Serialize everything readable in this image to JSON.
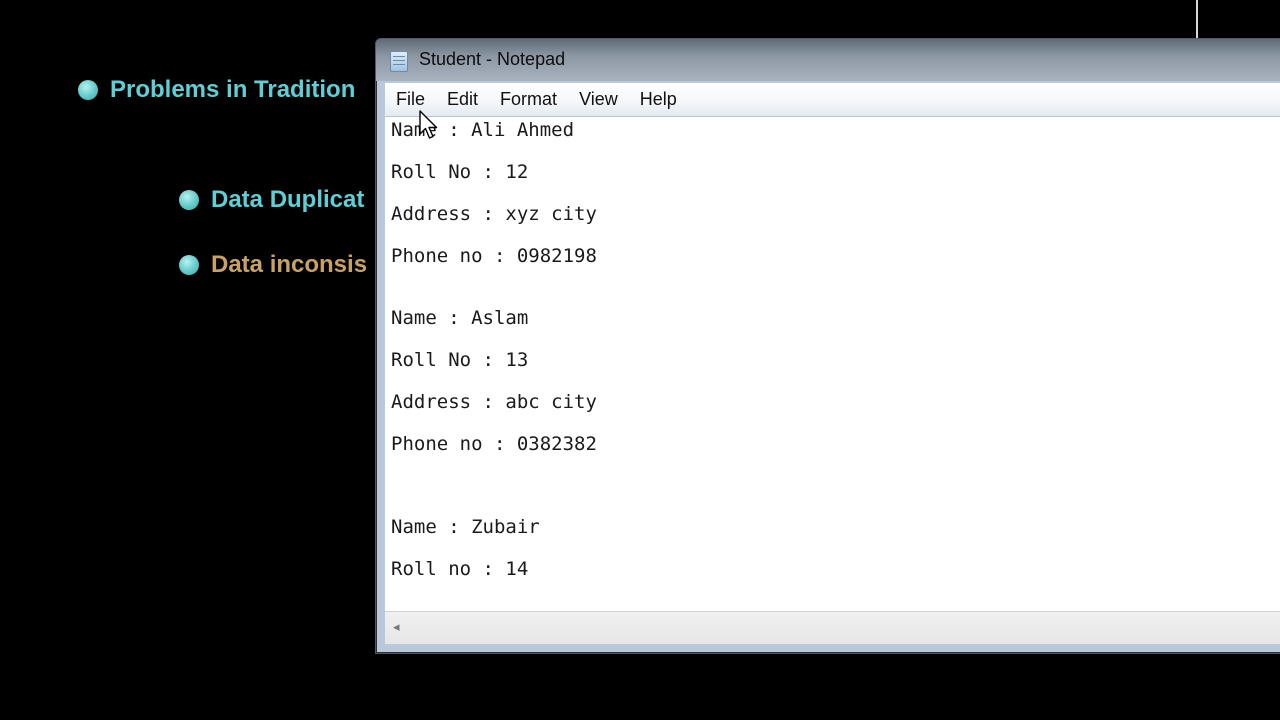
{
  "slide": {
    "bullets": [
      {
        "text": "Problems in Tradition",
        "color": "#5fcfd6"
      },
      {
        "text": "Data Duplicat",
        "color": "#5fcfd6"
      },
      {
        "text": "Data inconsis",
        "color": "#c7a264"
      }
    ]
  },
  "window": {
    "title": "Student - Notepad",
    "icon": "notepad-icon"
  },
  "menu": {
    "items": [
      "File",
      "Edit",
      "Format",
      "View",
      "Help"
    ]
  },
  "editor": {
    "lines": [
      "Name : Ali Ahmed",
      "Roll No : 12",
      "Address : xyz city",
      "Phone no : 0982198",
      "Name : Aslam",
      "Roll No : 13",
      "Address : abc city",
      "Phone no : 0382382",
      "Name : Zubair",
      "Roll no : 14"
    ]
  },
  "scrollbar": {
    "left_arrow": "◂"
  }
}
